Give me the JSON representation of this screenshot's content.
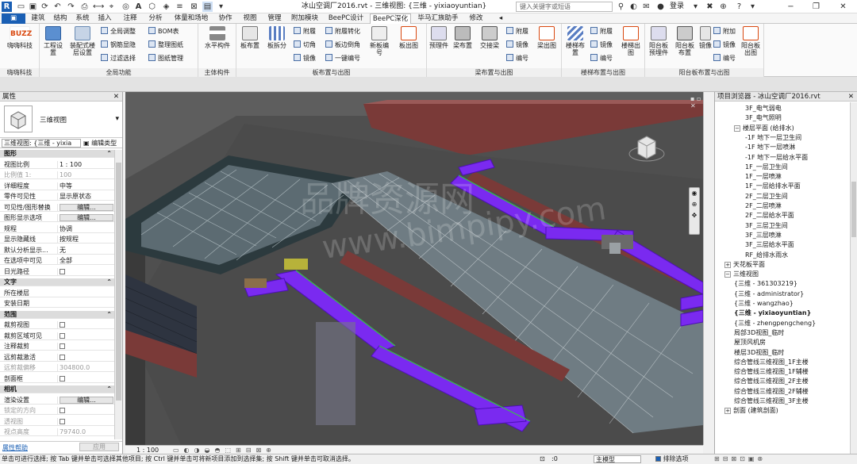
{
  "window": {
    "title": "冰山空调厂2016.rvt - 三维视图: {三维 - yixiaoyuntian}",
    "search_placeholder": "键入关键字或短语",
    "user": "登录"
  },
  "tabs": [
    "建筑",
    "结构",
    "系统",
    "插入",
    "注释",
    "分析",
    "体量和场地",
    "协作",
    "视图",
    "管理",
    "附加模块",
    "BeePC设计",
    "BeePC深化",
    "毕马汇族助手",
    "修改"
  ],
  "active_tab": "BeePC深化",
  "ribbon": {
    "g1": {
      "big": "嗨嗨科技",
      "label": "嗨嗨科技"
    },
    "g2": {
      "big1": "工程设置",
      "big2": "装配式楼层设置",
      "small": [
        "全局调整",
        "钢筋显隐",
        "过滤选择",
        "BOM表",
        "整理图纸",
        "图纸管理"
      ],
      "label": "全局功能"
    },
    "g3": {
      "big": "水平构件",
      "label": "主体构件"
    },
    "g4": {
      "big1": "板布置",
      "big2": "板拆分",
      "small": [
        "附履",
        "切角",
        "镜像",
        "附履转化",
        "板边倒角",
        "一键编号"
      ],
      "big3": "新板编号",
      "big4": "板出图",
      "label": "板布置与出图"
    },
    "g5": {
      "big1": "预理件",
      "big2": "梁布置",
      "big3": "交接梁",
      "small": [
        "附履",
        "镜像",
        "编号"
      ],
      "big4": "梁出图",
      "label": "梁布置与出图"
    },
    "g6": {
      "big1": "楼梯布置",
      "small": [
        "附履",
        "镜像",
        "编号"
      ],
      "big2": "楼梯出图",
      "label": "楼梯布置与出图"
    },
    "g7": {
      "big1": "阳台板预埋件",
      "big2": "阳台板布置",
      "big3": "镜像",
      "small": [
        "附加",
        "镜像",
        "编号"
      ],
      "big4": "阳台板出图",
      "label": "阳台板布置与出图"
    }
  },
  "properties": {
    "header": "属性",
    "type_name": "三维视图",
    "selector": "三维视图: {三维 - yixia",
    "edit_type": "编辑类型",
    "rows": [
      {
        "k": "图形",
        "v": "",
        "sec": true
      },
      {
        "k": "视图比例",
        "v": "1 : 100"
      },
      {
        "k": "比例值 1:",
        "v": "100",
        "dim": true
      },
      {
        "k": "详细程度",
        "v": "中等"
      },
      {
        "k": "零件可见性",
        "v": "显示原状态"
      },
      {
        "k": "可见性/图形替换",
        "v": "编辑...",
        "btn": true
      },
      {
        "k": "图形显示选项",
        "v": "编辑...",
        "btn": true
      },
      {
        "k": "规程",
        "v": "协调"
      },
      {
        "k": "显示隐藏线",
        "v": "按规程"
      },
      {
        "k": "默认分析显示...",
        "v": "无"
      },
      {
        "k": "在选项中可见",
        "v": "全部"
      },
      {
        "k": "日光路径",
        "v": "",
        "cb": true
      },
      {
        "k": "文字",
        "v": "",
        "sec": true
      },
      {
        "k": "所在楼层",
        "v": ""
      },
      {
        "k": "安装日期",
        "v": ""
      },
      {
        "k": "范围",
        "v": "",
        "sec": true
      },
      {
        "k": "裁剪视图",
        "v": "",
        "cb": true
      },
      {
        "k": "裁剪区域可见",
        "v": "",
        "cb": true
      },
      {
        "k": "注释裁剪",
        "v": "",
        "cb": true
      },
      {
        "k": "远剪裁激活",
        "v": "",
        "cb": true
      },
      {
        "k": "远剪裁偏移",
        "v": "304800.0",
        "dim": true
      },
      {
        "k": "剖面框",
        "v": "",
        "cb": true
      },
      {
        "k": "相机",
        "v": "",
        "sec": true
      },
      {
        "k": "渲染设置",
        "v": "编辑...",
        "btn": true
      },
      {
        "k": "锁定的方向",
        "v": "",
        "cb": true,
        "dim": true
      },
      {
        "k": "透视图",
        "v": "",
        "cb": true,
        "dim": true
      },
      {
        "k": "视点高度",
        "v": "79740.0",
        "dim": true
      }
    ],
    "help": "属性帮助",
    "apply": "应用"
  },
  "browser": {
    "header": "项目浏览器 - 冰山空调厂2016.rvt",
    "items": [
      {
        "t": "3F_电气弱电",
        "lvl": 3
      },
      {
        "t": "3F_电气照明",
        "lvl": 3
      },
      {
        "t": "楼层平面 (给排水)",
        "lvl": 2,
        "exp": "−"
      },
      {
        "t": "-1F 地下一层卫生间",
        "lvl": 3
      },
      {
        "t": "-1F 地下一层喷淋",
        "lvl": 3
      },
      {
        "t": "-1F 地下一层给水平面",
        "lvl": 3
      },
      {
        "t": "1F_一层卫生间",
        "lvl": 3
      },
      {
        "t": "1F_一层喷淋",
        "lvl": 3
      },
      {
        "t": "1F_一层给排水平面",
        "lvl": 3
      },
      {
        "t": "2F_二层卫生间",
        "lvl": 3
      },
      {
        "t": "2F_二层喷淋",
        "lvl": 3
      },
      {
        "t": "2F_二层给水平面",
        "lvl": 3
      },
      {
        "t": "3F_三层卫生间",
        "lvl": 3
      },
      {
        "t": "3F_三层喷淋",
        "lvl": 3
      },
      {
        "t": "3F_三层给水平面",
        "lvl": 3
      },
      {
        "t": "RF_给排水雨水",
        "lvl": 3
      },
      {
        "t": "天花板平面",
        "lvl": 1,
        "exp": "+"
      },
      {
        "t": "三维视图",
        "lvl": 1,
        "exp": "−"
      },
      {
        "t": "{三维 - 361303219}",
        "lvl": 2
      },
      {
        "t": "{三维 - administrator}",
        "lvl": 2
      },
      {
        "t": "{三维 - wangzhao}",
        "lvl": 2
      },
      {
        "t": "{三维 - yixiaoyuntian}",
        "lvl": 2,
        "bold": true
      },
      {
        "t": "{三维 - zhengpengcheng}",
        "lvl": 2
      },
      {
        "t": "局部3D视图_临时",
        "lvl": 2
      },
      {
        "t": "屋顶风机房",
        "lvl": 2
      },
      {
        "t": "楼层3D视图_临时",
        "lvl": 2
      },
      {
        "t": "综合管线三维视图_1F主楼",
        "lvl": 2
      },
      {
        "t": "综合管线三维视图_1F辅楼",
        "lvl": 2
      },
      {
        "t": "综合管线三维视图_2F主楼",
        "lvl": 2
      },
      {
        "t": "综合管线三维视图_2F辅楼",
        "lvl": 2
      },
      {
        "t": "综合管线三维视图_3F主楼",
        "lvl": 2
      },
      {
        "t": "剖面 (建筑剖面)",
        "lvl": 1,
        "exp": "+"
      }
    ]
  },
  "viewport": {
    "scale": "1 : 100",
    "watermark": "www.bimpipy.com",
    "watermark_cn": "品牌资源网"
  },
  "status": {
    "text": "单击可进行选择; 按 Tab 键并单击可选择其他项目; 按 Ctrl 键并单击可将新项目添加到选择集; 按 Shift 键并单击可取消选择。",
    "model": "主模型",
    "exclude": "排除选项",
    "coord": ":0"
  },
  "colors": {
    "duct": "#7a2af0",
    "roof": "#4a4a4a",
    "wall": "#8a4a48",
    "glass": "#6b7f8c"
  }
}
